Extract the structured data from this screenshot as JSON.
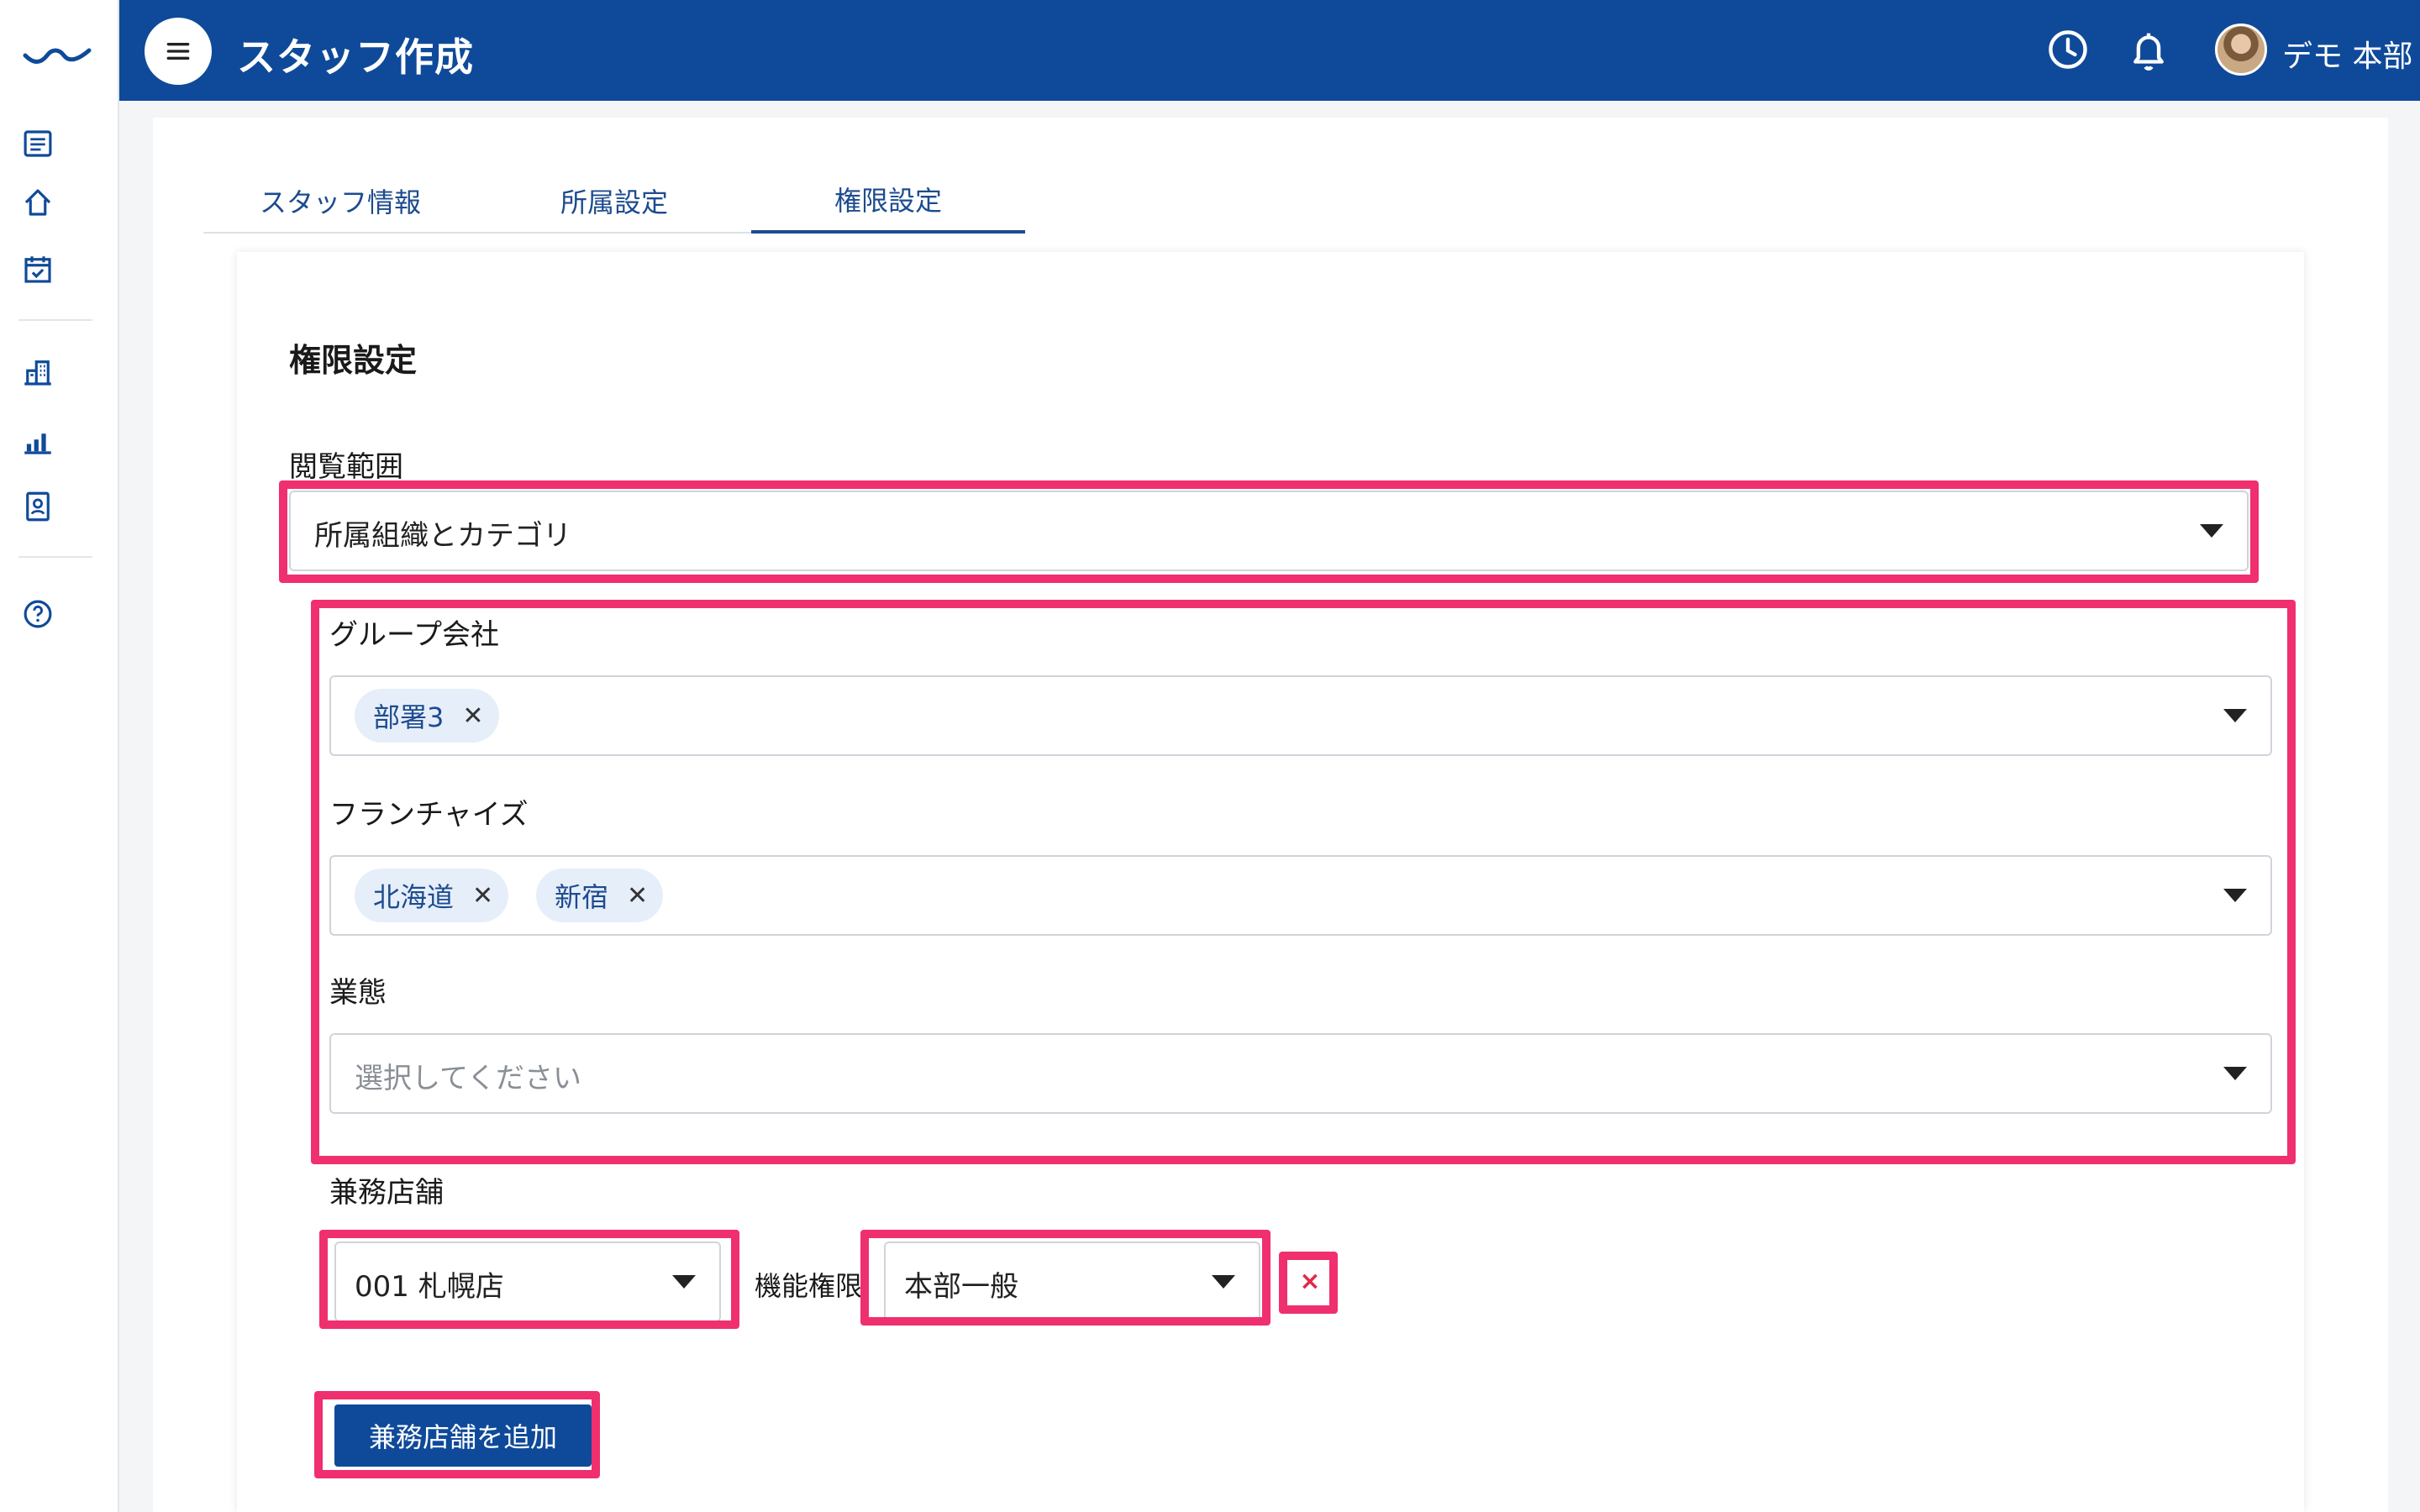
{
  "header": {
    "title": "スタッフ作成",
    "user_name": "デモ 本部",
    "icons": [
      "menu-icon",
      "clock-icon",
      "bell-icon"
    ],
    "bg_color": "#0f4a9a"
  },
  "sidebar": {
    "icons": [
      "logo",
      "list-icon",
      "home-icon",
      "calendar-check-icon",
      "building-icon",
      "bar-chart-icon",
      "id-card-icon",
      "help-icon"
    ]
  },
  "tabs": [
    {
      "label": "スタッフ情報",
      "active": false
    },
    {
      "label": "所属設定",
      "active": false
    },
    {
      "label": "権限設定",
      "active": true
    }
  ],
  "form": {
    "section_title": "権限設定",
    "view_scope": {
      "label": "閲覧範囲",
      "value": "所属組織とカテゴリ"
    },
    "group_company": {
      "label": "グループ会社",
      "chips": [
        "部署3"
      ]
    },
    "franchise": {
      "label": "フランチャイズ",
      "chips": [
        "北海道",
        "新宿"
      ]
    },
    "business_type": {
      "label": "業態",
      "placeholder": "選択してください"
    },
    "concurrent_store": {
      "label": "兼務店舗",
      "store_value": "001 札幌店",
      "permission_label": "機能権限",
      "permission_value": "本部一般",
      "remove_symbol": "×",
      "add_button": "兼務店舗を追加"
    }
  },
  "chip_remove_symbol": "✕",
  "highlight_color": "#ef2f6e"
}
